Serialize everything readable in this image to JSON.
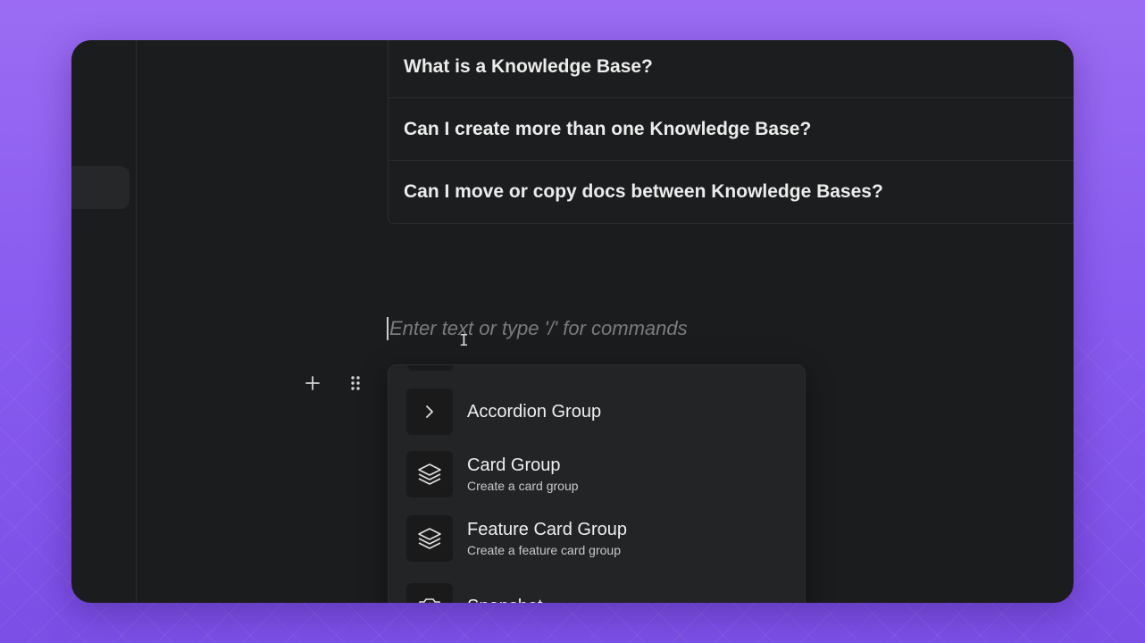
{
  "faq": {
    "items": [
      {
        "question": "What is a Knowledge Base?"
      },
      {
        "question": "Can I create more than one Knowledge Base?"
      },
      {
        "question": "Can I move or copy docs between Knowledge Bases?"
      }
    ]
  },
  "editor": {
    "placeholder": "Enter text or type '/' for commands",
    "value": ""
  },
  "block_controls": {
    "add_icon": "plus-icon",
    "drag_icon": "drag-handle-icon"
  },
  "command_menu": {
    "items": [
      {
        "title": "Accordion Group",
        "description": "",
        "icon": "chevron-right-icon"
      },
      {
        "title": "Card Group",
        "description": "Create a card group",
        "icon": "layers-icon"
      },
      {
        "title": "Feature Card Group",
        "description": "Create a feature card group",
        "icon": "layers-icon"
      },
      {
        "title": "Snapshot",
        "description": "",
        "icon": "camera-icon"
      }
    ]
  },
  "colors": {
    "background_accent": "#8a5cf0",
    "window_bg": "#1b1c1d",
    "menu_bg": "#232426"
  }
}
